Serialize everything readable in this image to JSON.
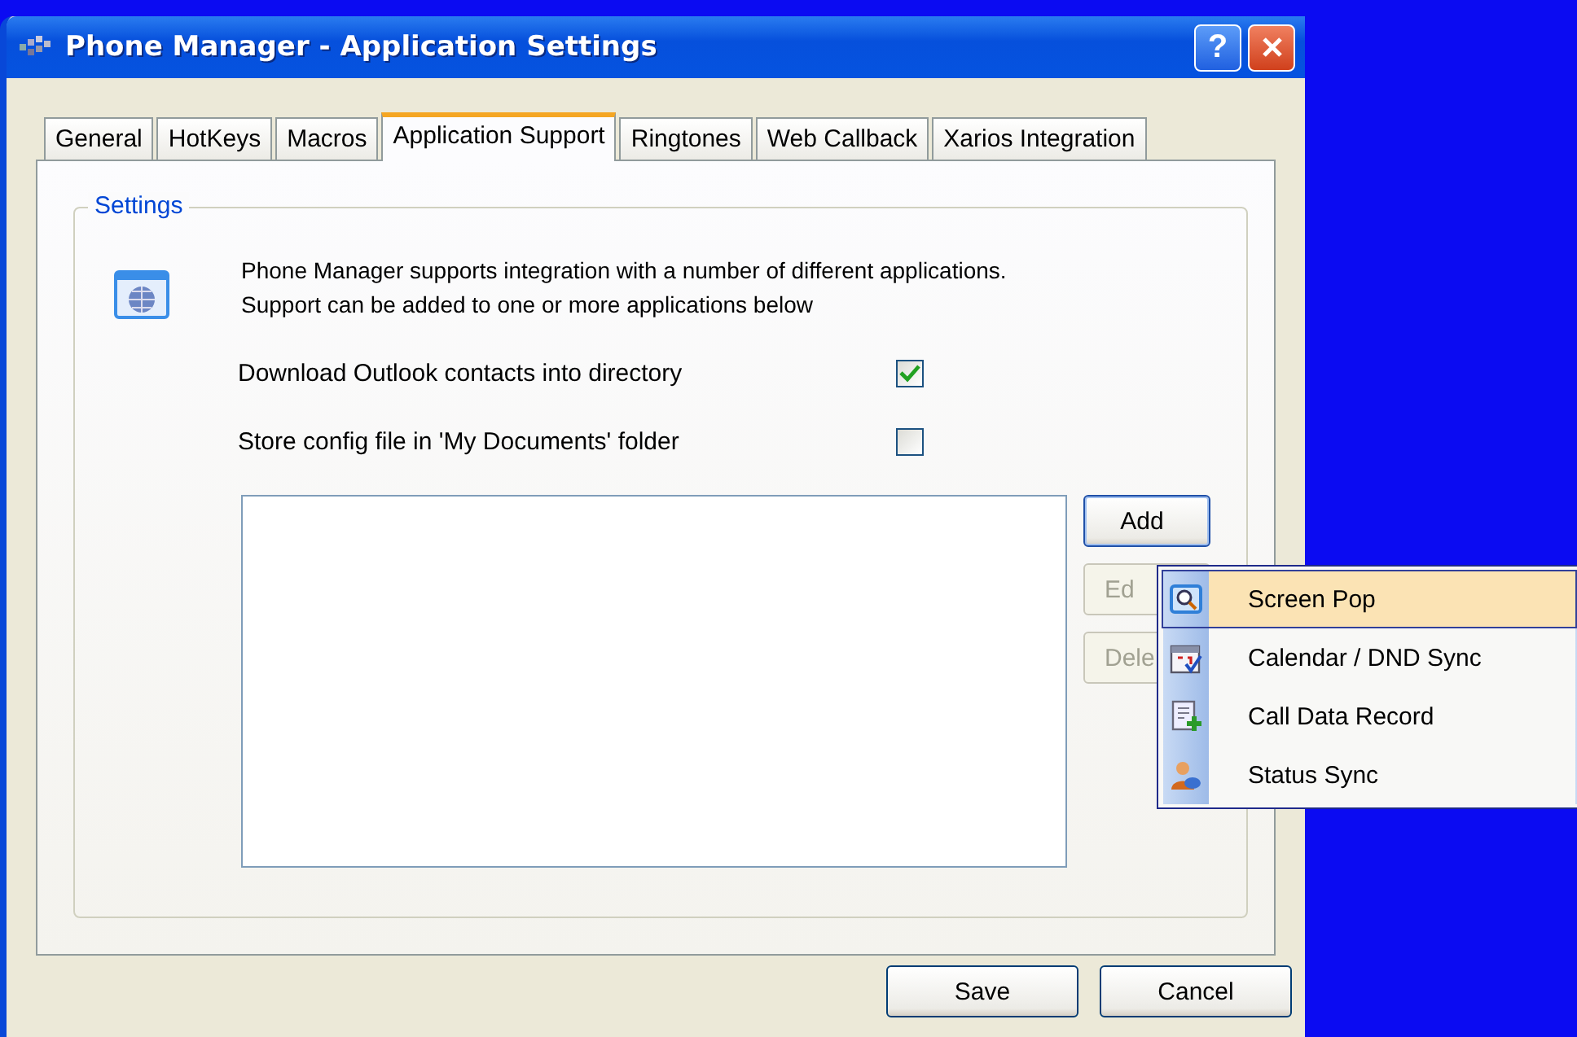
{
  "window": {
    "title": "Phone Manager - Application Settings",
    "help_label": "?"
  },
  "tabs": [
    {
      "label": "General",
      "selected": false
    },
    {
      "label": "HotKeys",
      "selected": false
    },
    {
      "label": "Macros",
      "selected": false
    },
    {
      "label": "Application Support",
      "selected": true
    },
    {
      "label": "Ringtones",
      "selected": false
    },
    {
      "label": "Web Callback",
      "selected": false
    },
    {
      "label": "Xarios Integration",
      "selected": false
    }
  ],
  "settings": {
    "title": "Settings",
    "description": "Phone Manager supports integration with a number of different applications.  Support can be added to one or more applications below",
    "options": [
      {
        "label": "Download Outlook contacts into directory",
        "checked": true
      },
      {
        "label": "Store config file in 'My Documents' folder",
        "checked": false
      }
    ]
  },
  "side_buttons": [
    {
      "label": "Add",
      "disabled": false
    },
    {
      "label": "Ed",
      "disabled": true
    },
    {
      "label": "Dele",
      "disabled": true
    }
  ],
  "menu": [
    {
      "label": "Screen Pop",
      "kind": "search",
      "selected": true
    },
    {
      "label": "Calendar / DND Sync",
      "kind": "calendar",
      "selected": false
    },
    {
      "label": "Call Data Record",
      "kind": "document",
      "selected": false
    },
    {
      "label": "Status Sync",
      "kind": "person",
      "selected": false
    }
  ],
  "footer_buttons": [
    "Save",
    "Cancel"
  ]
}
